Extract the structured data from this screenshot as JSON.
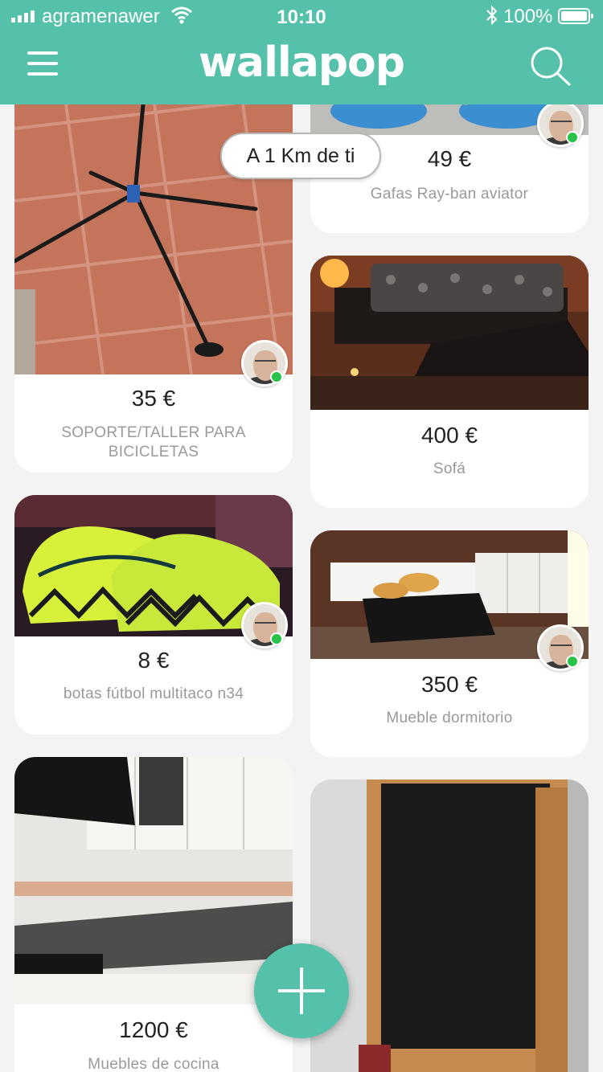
{
  "status_bar": {
    "carrier": "agramenawer",
    "time": "10:10",
    "battery": "100%"
  },
  "header": {
    "logo": "wallapop",
    "menu_icon": "hamburger-menu-icon",
    "search_icon": "search-icon"
  },
  "distance_filter": "A 1 Km de ti",
  "items": [
    {
      "price": "49 €",
      "title": "Gafas Ray-ban aviator"
    },
    {
      "price": "35 €",
      "title": "SOPORTE/TALLER PARA BICICLETAS"
    },
    {
      "price": "400 €",
      "title": "Sofá"
    },
    {
      "price": "8 €",
      "title": "botas fútbol multitaco n34"
    },
    {
      "price": "350 €",
      "title": "Mueble dormitorio"
    },
    {
      "price": "1200 €",
      "title": "Muebles de cocina"
    },
    {
      "price": "",
      "title": ""
    }
  ],
  "fab_icon": "plus-icon",
  "colors": {
    "brand": "#56c1aa",
    "online": "#29c24a"
  }
}
